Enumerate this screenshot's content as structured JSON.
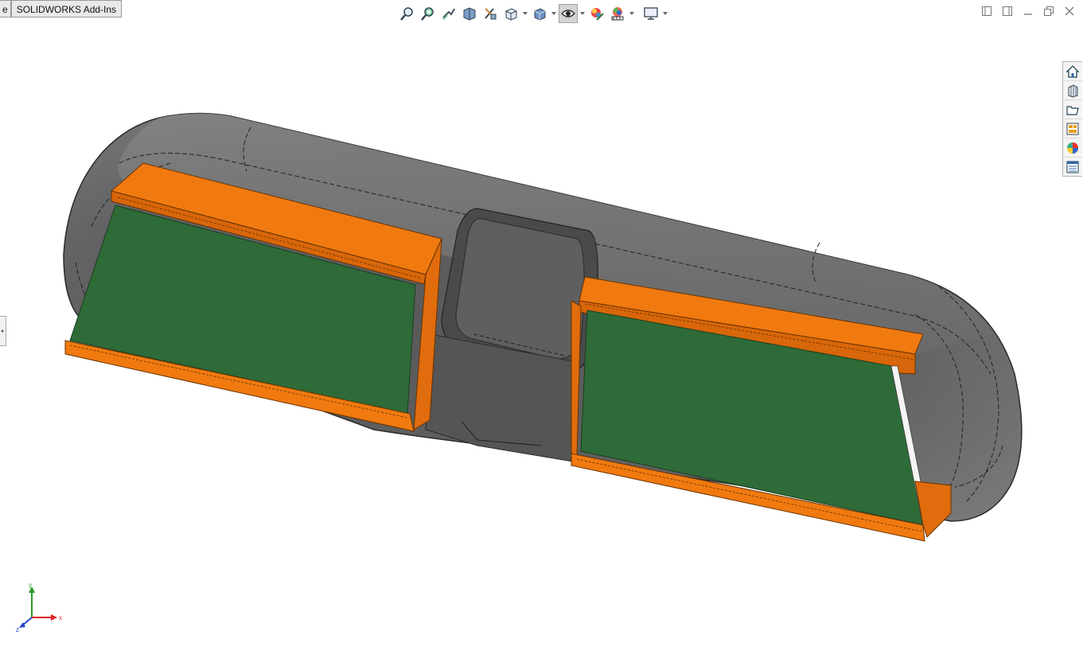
{
  "tabs": {
    "partial_label": "e",
    "addins_label": "SOLIDWORKS Add-Ins"
  },
  "headsup_toolbar": [
    "zoom-to-fit-icon",
    "zoom-to-area-icon",
    "previous-view-icon",
    "section-view-icon",
    "dynamic-annotation-views-icon",
    "view-orientation-icon",
    "display-style-icon",
    "hide-show-items-icon",
    "edit-appearance-icon",
    "apply-scene-icon",
    "view-settings-icon"
  ],
  "task_pane": [
    "solidworks-resources-icon",
    "design-library-icon",
    "file-explorer-icon",
    "view-palette-icon",
    "appearances-scenes-decals-icon",
    "custom-properties-icon"
  ],
  "triad": {
    "x_label": "x",
    "y_label": "y",
    "z_label": "z"
  },
  "colors": {
    "body_gray": "#5f5f5f",
    "frame_orange": "#f07a10",
    "pcb_green": "#2e6b38",
    "viewport_bg": "#ffffff"
  }
}
